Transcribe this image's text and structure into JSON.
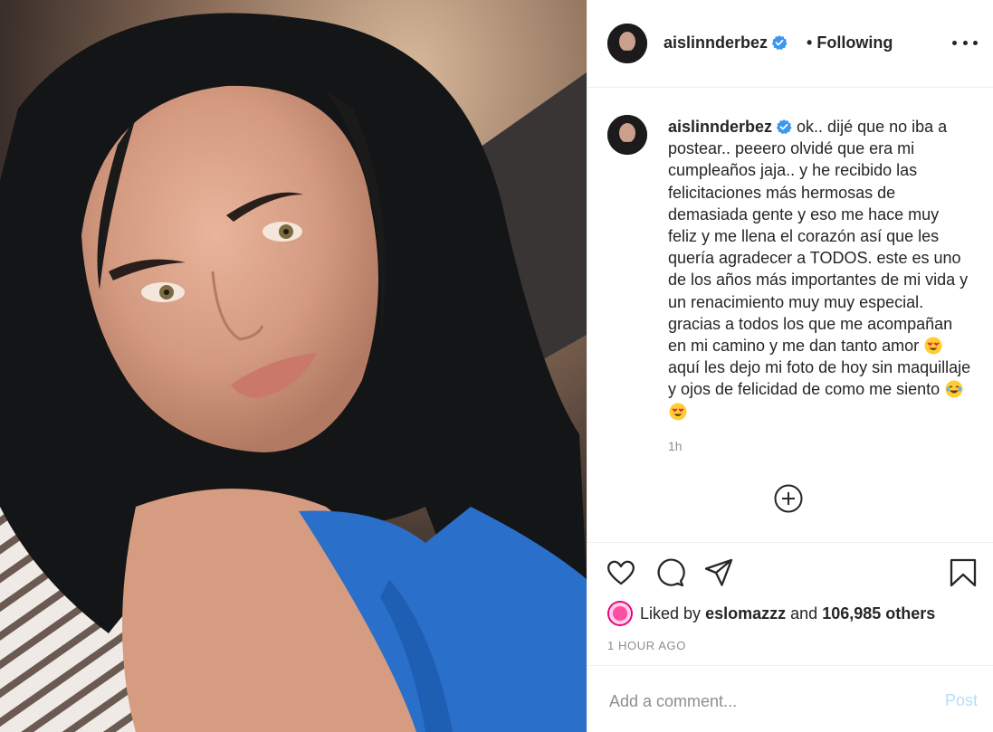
{
  "post": {
    "username": "aislinnderbez",
    "separator": "•",
    "follow_state": "Following",
    "caption": {
      "text_part1": "ok.. dijé que no iba a postear.. peeero olvidé que era mi cumpleaños jaja.. y he recibido las felicitaciones más hermosas de demasiada gente y eso me hace muy feliz y me llena el corazón así que les quería agradecer a TODOS. este es uno de los años más importantes de mi vida y un renacimiento muy muy especial. gracias a todos los que me acompañan en mi camino y me dan tanto amor",
      "text_part2": "aquí les dejo mi foto de hoy sin maquillaje y ojos de felicidad de como me siento",
      "time": "1h"
    },
    "likes": {
      "prefix": "Liked by",
      "user": "eslomazzz",
      "conjunction": "and",
      "count": "106,985 others"
    },
    "timestamp": "1 HOUR AGO",
    "comment": {
      "placeholder": "Add a comment...",
      "post_label": "Post"
    }
  },
  "colors": {
    "verified": "#3897f0",
    "post_button_disabled": "#b2dffc",
    "muted_text": "#8e8e8e"
  },
  "icons": [
    "more-options-icon",
    "verified-icon",
    "load-more-comments-icon",
    "heart-icon",
    "comment-icon",
    "share-icon",
    "bookmark-icon"
  ]
}
